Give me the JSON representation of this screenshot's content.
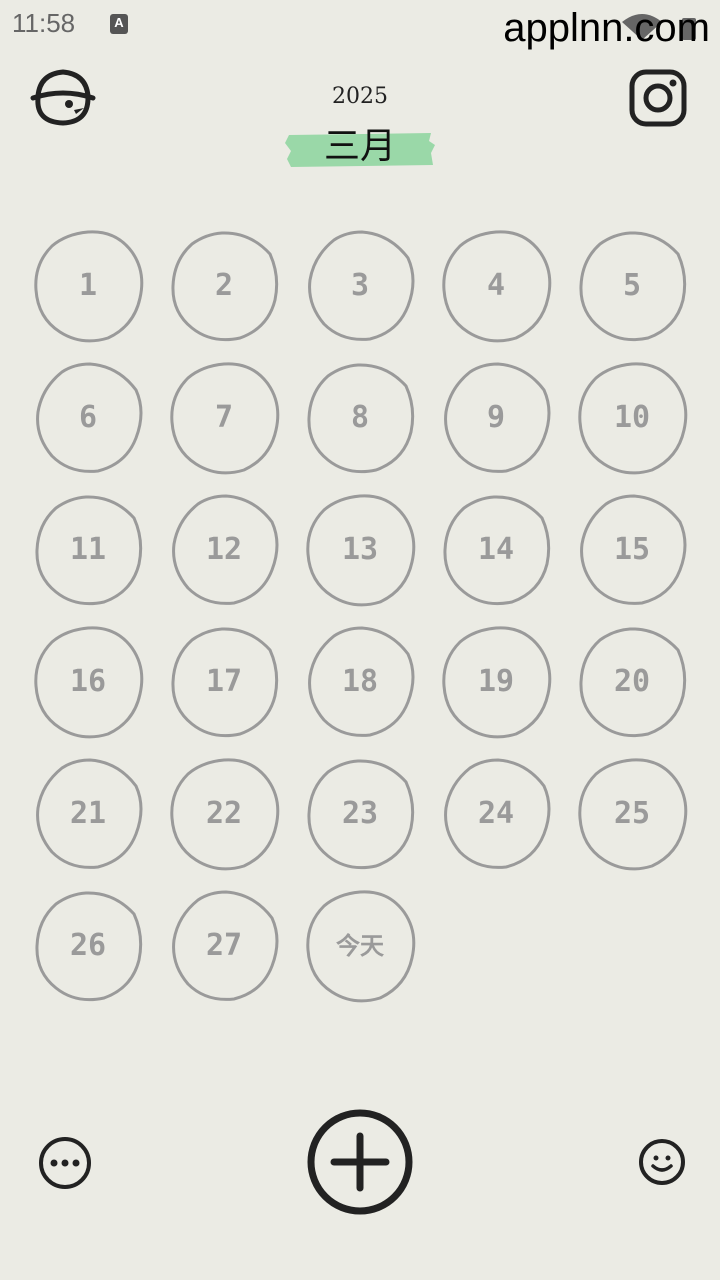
{
  "status_bar": {
    "time": "11:58",
    "notification_icon": "a-letter-icon",
    "notification_label": "A",
    "signal_icon": "wifi-icon",
    "battery_icon": "battery-icon"
  },
  "watermark": "applnn.com",
  "header": {
    "year": "2025",
    "month": "三月",
    "accent_color": "#9ad8a8"
  },
  "icons": {
    "top_left": "bird-hat-avatar-icon",
    "top_right": "instagram-icon",
    "bottom_left": "more-options-icon",
    "bottom_center": "add-icon",
    "bottom_right": "smile-icon"
  },
  "days": [
    "1",
    "2",
    "3",
    "4",
    "5",
    "6",
    "7",
    "8",
    "9",
    "10",
    "11",
    "12",
    "13",
    "14",
    "15",
    "16",
    "17",
    "18",
    "19",
    "20",
    "21",
    "22",
    "23",
    "24",
    "25",
    "26",
    "27",
    "今天"
  ],
  "colors": {
    "background": "#ebebe4",
    "day_outline": "#9a9a9a",
    "day_text": "#9a9a9a",
    "icon": "#222222"
  }
}
